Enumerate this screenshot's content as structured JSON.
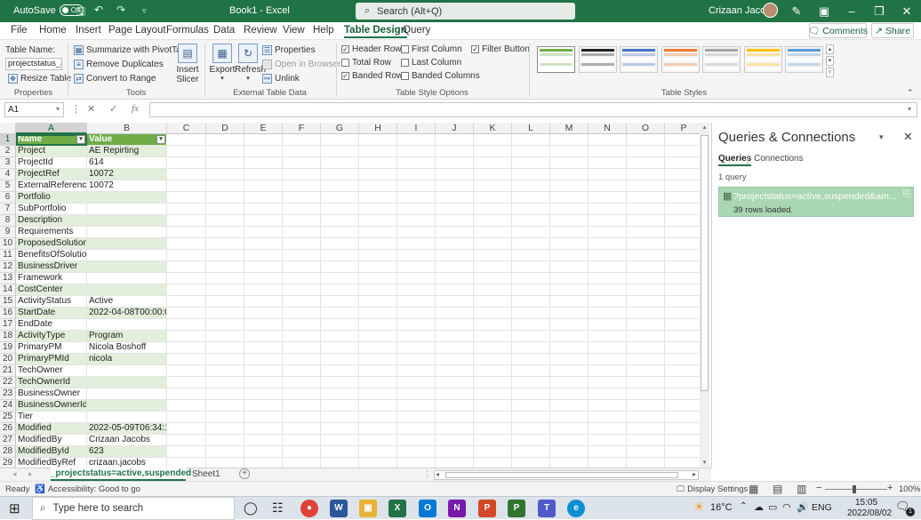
{
  "titlebar": {
    "autosave_label": "AutoSave",
    "autosave_state": "Off",
    "doc_title": "Book1  -  Excel",
    "search_placeholder": "Search (Alt+Q)",
    "user_name": "Crizaan Jacobs"
  },
  "menu": {
    "items": [
      "File",
      "Home",
      "Insert",
      "Page Layout",
      "Formulas",
      "Data",
      "Review",
      "View",
      "Help",
      "Table Design",
      "Query"
    ],
    "active": "Table Design",
    "comments_label": "Comments",
    "share_label": "Share"
  },
  "ribbon": {
    "properties": {
      "table_name_label": "Table Name:",
      "table_name_value": "projectstatus_acti",
      "resize_label": "Resize Table",
      "group_label": "Properties"
    },
    "tools": {
      "summarize_label": "Summarize with PivotTable",
      "remove_dupes_label": "Remove Duplicates",
      "convert_label": "Convert to Range",
      "insert_slicer_line1": "Insert",
      "insert_slicer_line2": "Slicer",
      "group_label": "Tools"
    },
    "external": {
      "export_label": "Export",
      "refresh_label": "Refresh",
      "properties_label": "Properties",
      "open_browser_label": "Open in Browser",
      "unlink_label": "Unlink",
      "group_label": "External Table Data"
    },
    "style_options": {
      "header_row": "Header Row",
      "total_row": "Total Row",
      "banded_rows": "Banded Rows",
      "first_column": "First Column",
      "last_column": "Last Column",
      "banded_columns": "Banded Columns",
      "filter_button": "Filter Button",
      "group_label": "Table Style Options"
    },
    "styles": {
      "group_label": "Table Styles",
      "swatch_colors": [
        "#70ad47",
        "#222222",
        "#4472c4",
        "#ed7d31",
        "#a5a5a5",
        "#ffc000",
        "#5b9bd5"
      ]
    }
  },
  "formula_bar": {
    "name_box": "A1",
    "fx_label": "fx",
    "formula": ""
  },
  "sheet": {
    "columns": [
      "A",
      "B",
      "C",
      "D",
      "E",
      "F",
      "G",
      "H",
      "I",
      "J",
      "K",
      "L",
      "M",
      "N",
      "O",
      "P"
    ],
    "header": [
      "Name",
      "Value"
    ],
    "rows": [
      [
        "Project",
        "AE Repirting"
      ],
      [
        "ProjectId",
        "614"
      ],
      [
        "ProjectRef",
        "10072"
      ],
      [
        "ExternalReference",
        "10072"
      ],
      [
        "Portfolio",
        ""
      ],
      [
        "SubPortfolio",
        ""
      ],
      [
        "Description",
        ""
      ],
      [
        "Requirements",
        ""
      ],
      [
        "ProposedSolution",
        ""
      ],
      [
        "BenefitsOfSolution",
        ""
      ],
      [
        "BusinessDriver",
        ""
      ],
      [
        "Framework",
        ""
      ],
      [
        "CostCenter",
        ""
      ],
      [
        "ActivityStatus",
        "Active"
      ],
      [
        "StartDate",
        "2022-04-08T00:00:00"
      ],
      [
        "EndDate",
        ""
      ],
      [
        "ActivityType",
        "Program"
      ],
      [
        "PrimaryPM",
        "Nicola Boshoff"
      ],
      [
        "PrimaryPMId",
        "nicola"
      ],
      [
        "TechOwner",
        ""
      ],
      [
        "TechOwnerId",
        ""
      ],
      [
        "BusinessOwner",
        ""
      ],
      [
        "BusinessOwnerId",
        ""
      ],
      [
        "Tier",
        ""
      ],
      [
        "Modified",
        "2022-05-09T06:34:10"
      ],
      [
        "ModifiedBy",
        "Crizaan Jacobs"
      ],
      [
        "ModifiedById",
        "623"
      ],
      [
        "ModifiedByRef",
        "crizaan.jacobs"
      ]
    ],
    "row_numbers": [
      "1",
      "2",
      "3",
      "4",
      "5",
      "6",
      "7",
      "8",
      "9",
      "10",
      "11",
      "12",
      "13",
      "14",
      "15",
      "16",
      "17",
      "18",
      "19",
      "20",
      "21",
      "22",
      "23",
      "24",
      "25",
      "26",
      "27",
      "28",
      "29"
    ],
    "tab_active": "_projectstatus=active,suspended",
    "tab_other": "Sheet1",
    "header_color": "#70ad47",
    "band_color": "#e2efda"
  },
  "pane": {
    "title": "Queries & Connections",
    "tab_queries": "Queries",
    "tab_connections": "Connections",
    "count": "1 query",
    "query_name": "?projectstatus=active,suspended&am...",
    "query_status": "39 rows loaded."
  },
  "status": {
    "ready": "Ready",
    "accessibility": "Accessibility: Good to go",
    "display_settings": "Display Settings",
    "zoom": "100%"
  },
  "taskbar": {
    "search_placeholder": "Type here to search",
    "weather": "16°C",
    "lang": "ENG",
    "time": "15:05",
    "date": "2022/08/02",
    "notifications": "1"
  }
}
